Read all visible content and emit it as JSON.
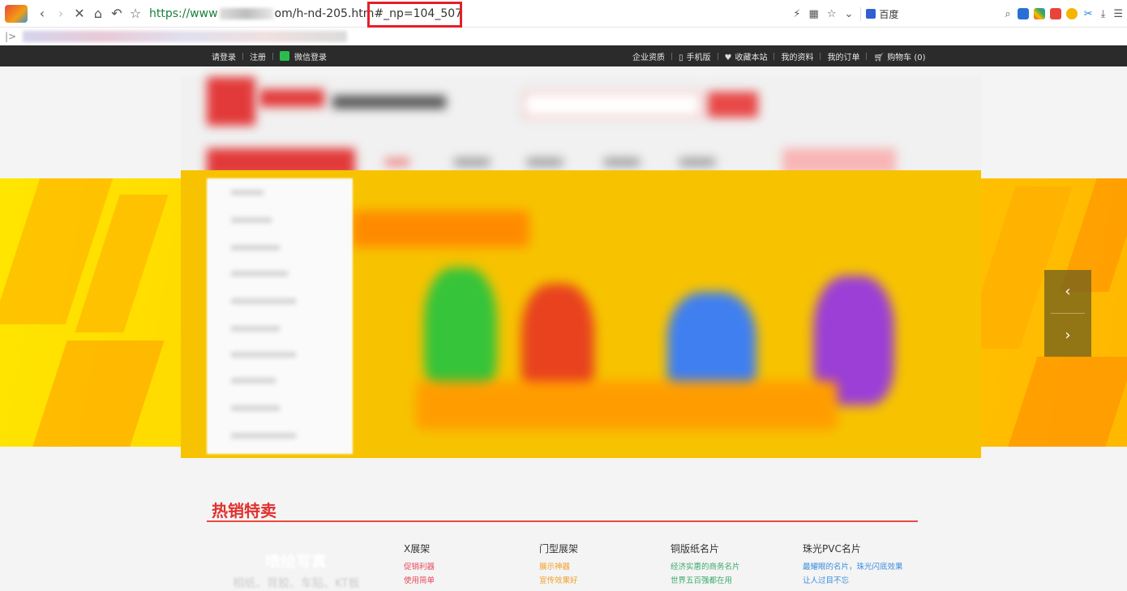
{
  "browser": {
    "url_scheme": "https://www",
    "url_mid": "om/h-nd-205.htm",
    "url_fragment": "#_np=104_507",
    "search_engine": "百度",
    "highlight_color": "#e3202a"
  },
  "site_nav": {
    "left": [
      "请登录",
      "注册",
      "微信登录"
    ],
    "right": [
      "企业资质",
      "手机版",
      "收藏本站",
      "我的资料",
      "我的订单",
      "购物车 (0)"
    ]
  },
  "hot_sale": {
    "title": "热销特卖",
    "promo": {
      "title": "喷绘写真",
      "subtitle": "相纸、背胶、车贴、KT板"
    },
    "products": [
      {
        "name": "X展架",
        "subs": [
          "促销利器",
          "使用简单"
        ],
        "color": "#e8495a"
      },
      {
        "name": "门型展架",
        "subs": [
          "展示神器",
          "宣传效果好"
        ],
        "color": "#f29f2a"
      },
      {
        "name": "铜版纸名片",
        "subs": [
          "经济实惠的商务名片",
          "世界五百强都在用"
        ],
        "color": "#3bab6b"
      },
      {
        "name": "珠光PVC名片",
        "subs": [
          "最耀眼的名片，珠光闪底效果",
          "让人过目不忘"
        ],
        "color": "#3b8ee0"
      }
    ]
  },
  "icons": {
    "back": "chevron-left-icon",
    "forward": "chevron-right-icon",
    "stop": "close-icon",
    "home": "home-icon",
    "undo": "undo-icon",
    "star": "star-icon"
  }
}
